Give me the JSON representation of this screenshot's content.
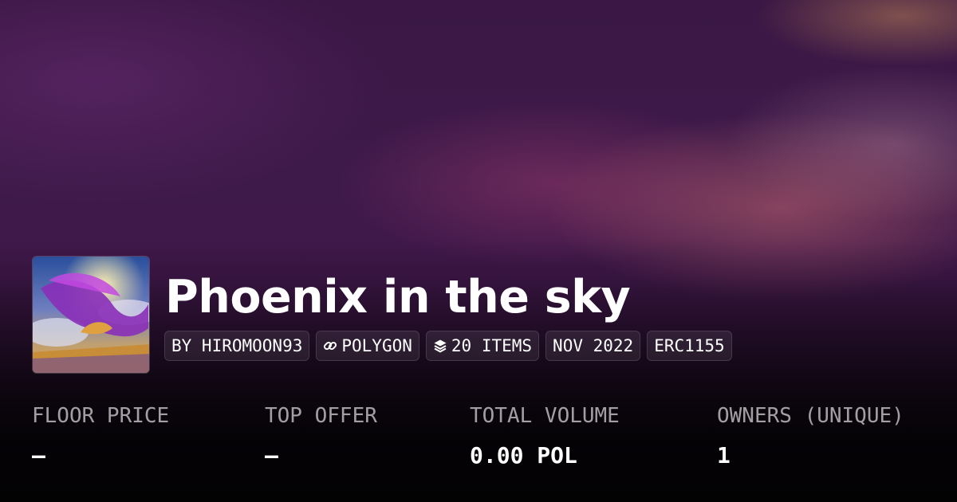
{
  "collection": {
    "title": "Phoenix in the sky",
    "badges": {
      "creator": "BY HIROMOON93",
      "chain": "POLYGON",
      "items": "20 ITEMS",
      "date": "NOV 2022",
      "standard": "ERC1155"
    }
  },
  "stats": {
    "floor_price": {
      "label": "FLOOR PRICE",
      "value": "–"
    },
    "top_offer": {
      "label": "TOP OFFER",
      "value": "–"
    },
    "total_volume": {
      "label": "TOTAL VOLUME",
      "value": "0.00 POL"
    },
    "owners": {
      "label": "OWNERS (UNIQUE)",
      "value": "1"
    }
  },
  "icons": {
    "chain": "link-icon",
    "items": "layers-icon"
  },
  "colors": {
    "background": "#3e1a4a",
    "text": "#ffffff",
    "muted_text": "#a59aa8"
  }
}
